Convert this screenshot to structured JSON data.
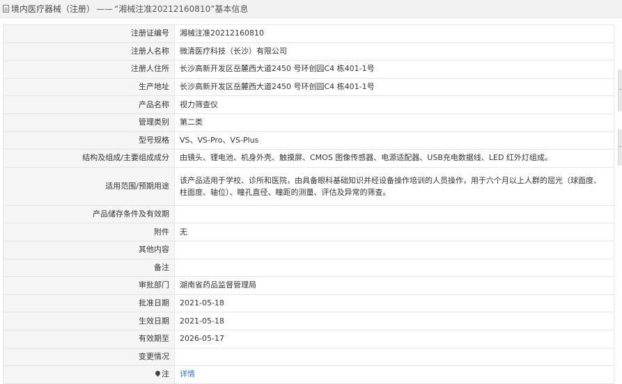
{
  "header": {
    "title": "境内医疗器械（注册）",
    "separator": "——",
    "subtitle": "“湘械注准20212160810”基本信息"
  },
  "rows": [
    {
      "label": "注册证编号",
      "value": "湘械注准20212160810"
    },
    {
      "label": "注册人名称",
      "value": "微清医疗科技（长沙）有限公司"
    },
    {
      "label": "注册人住所",
      "value": "长沙高新开发区岳麓西大道2450 号环创园C4 栋401-1号"
    },
    {
      "label": "生产地址",
      "value": "长沙高新开发区岳麓西大道2450 号环创园C4 栋401-1号"
    },
    {
      "label": "产品名称",
      "value": "视力筛查仪"
    },
    {
      "label": "管理类别",
      "value": "第二类"
    },
    {
      "label": "型号规格",
      "value": "VS、VS-Pro、VS-Plus"
    },
    {
      "label": "结构及组成/主要组成成分",
      "value": "由镜头、锂电池、机身外壳、触摸屏、CMOS 图像传感器、电源适配器、USB充电数据线、LED 红外灯组成。"
    },
    {
      "label": "适用范围/预期用途",
      "value": "该产品适用于学校、诊所和医院，由具备眼科基础知识并经设备操作培训的人员操作，用于六个月以上人群的屈光（球面度、柱面度、轴位）、瞳孔直径、瞳距的测量、评估及异常的筛查。"
    },
    {
      "label": "产品储存条件及有效期",
      "value": ""
    },
    {
      "label": "附件",
      "value": "无"
    },
    {
      "label": "其他内容",
      "value": ""
    },
    {
      "label": "备注",
      "value": ""
    },
    {
      "label": "审批部门",
      "value": "湖南省药品监督管理局"
    },
    {
      "label": "批准日期",
      "value": "2021-05-18"
    },
    {
      "label": "生效日期",
      "value": "2021-05-18"
    },
    {
      "label": "有效期至",
      "value": "2026-05-17"
    },
    {
      "label": "变更情况",
      "value": ""
    }
  ],
  "note": {
    "label": "注",
    "link_text": "详情",
    "icon": "pin-icon"
  }
}
